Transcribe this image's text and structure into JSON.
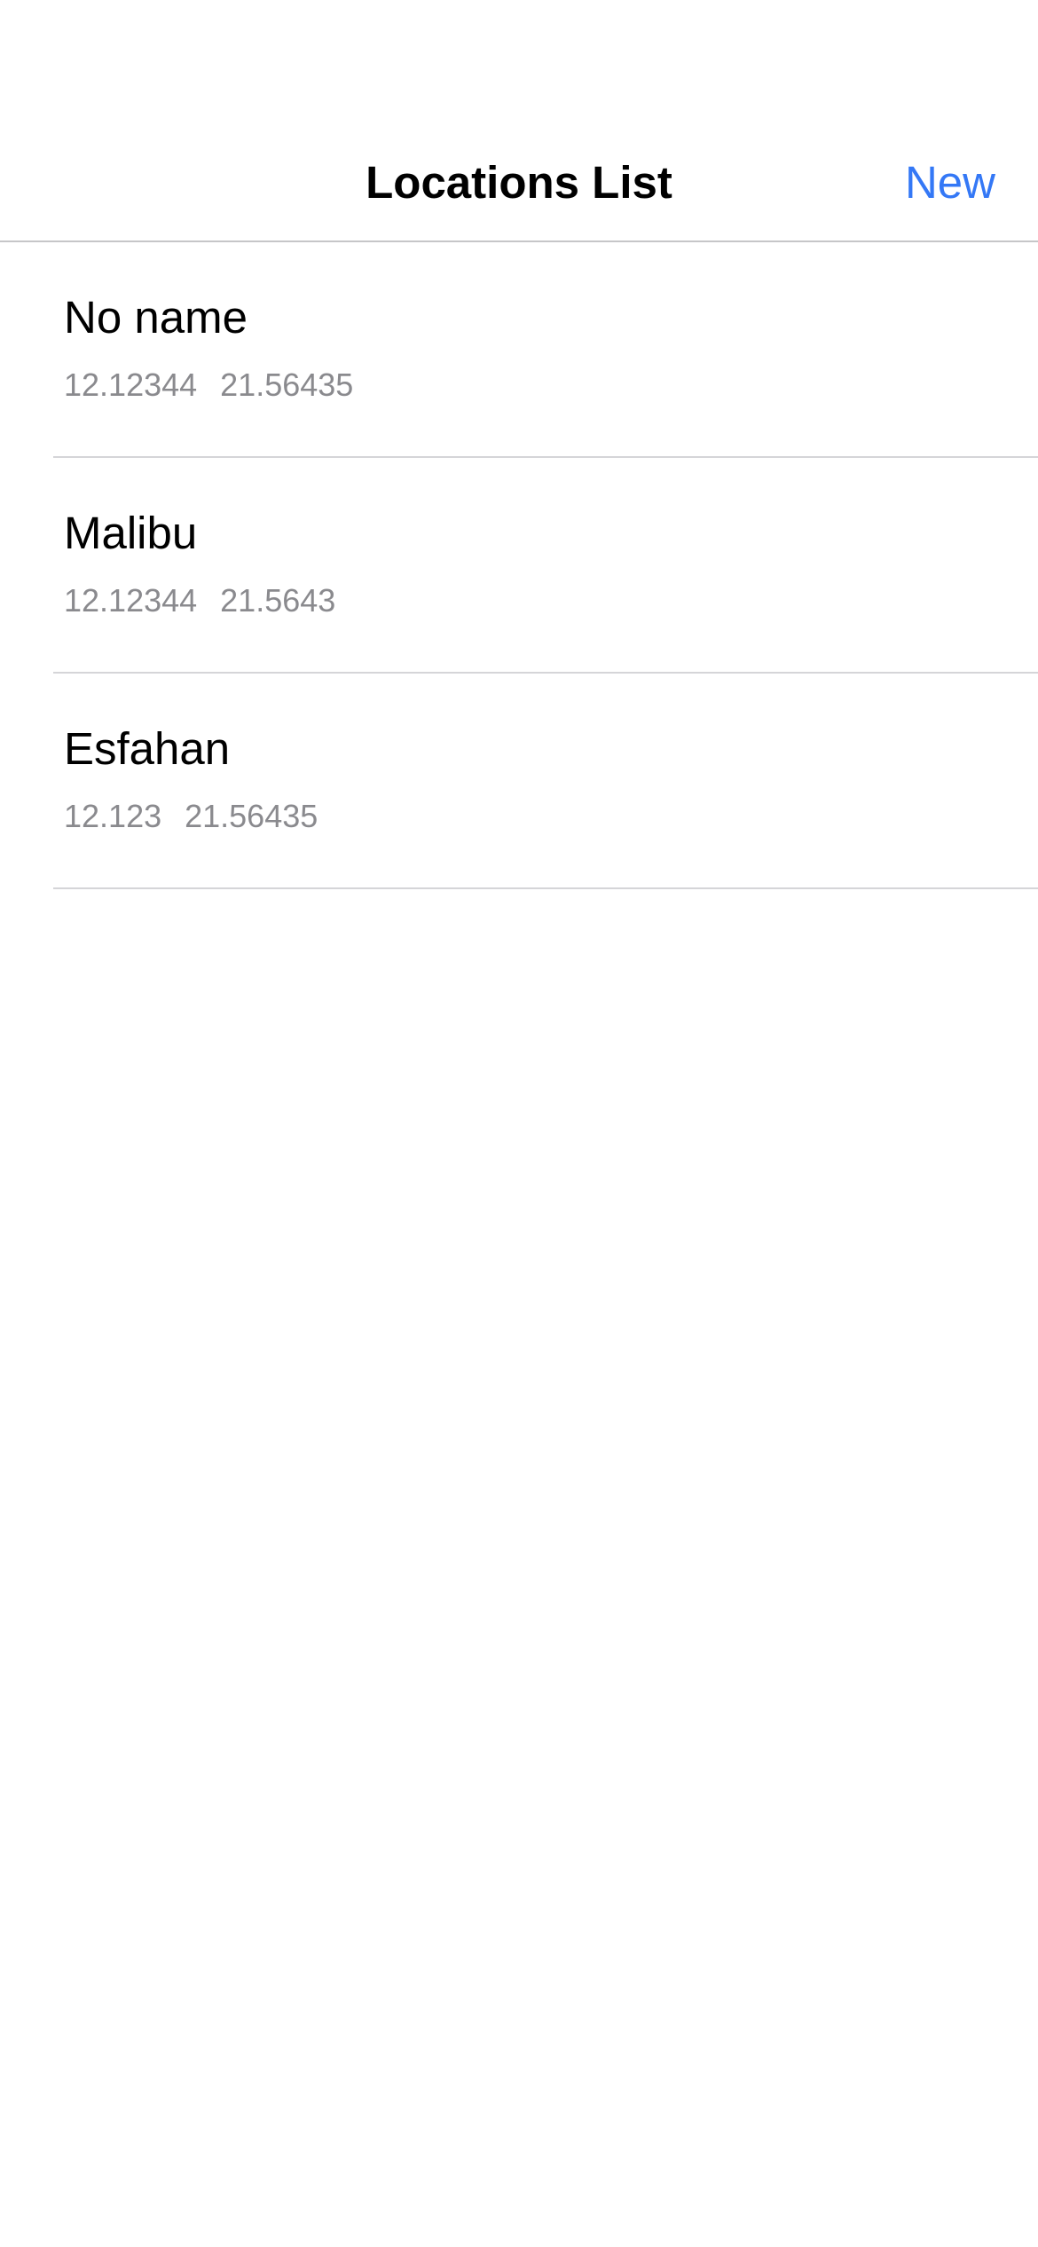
{
  "nav": {
    "title": "Locations List",
    "new_label": "New"
  },
  "colors": {
    "accent": "#3478f6",
    "secondary_text": "#8a8a8e",
    "separator": "#d5d5d8"
  },
  "locations": [
    {
      "name": "No name",
      "latitude": "12.12344",
      "longitude": "21.56435"
    },
    {
      "name": "Malibu",
      "latitude": "12.12344",
      "longitude": "21.5643"
    },
    {
      "name": "Esfahan",
      "latitude": "12.123",
      "longitude": "21.56435"
    }
  ]
}
